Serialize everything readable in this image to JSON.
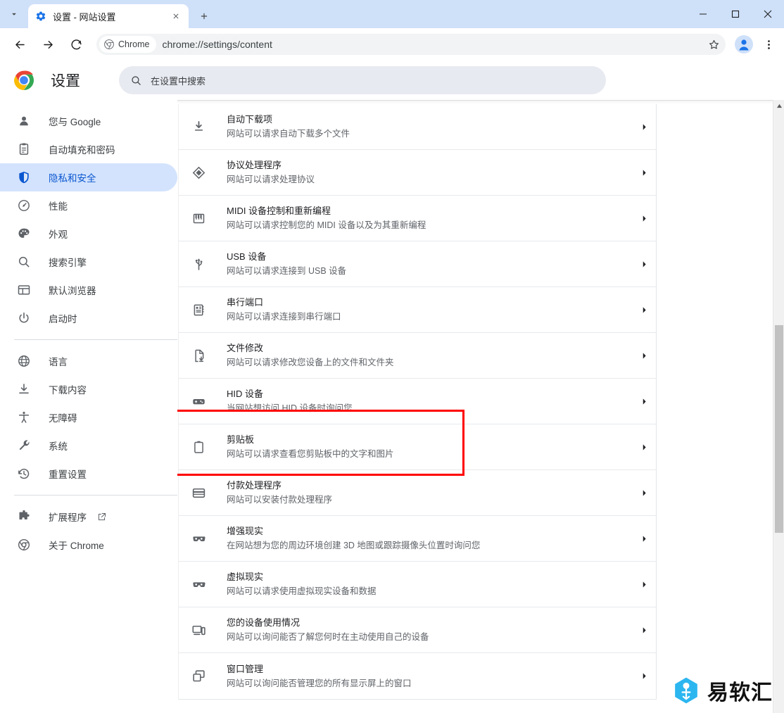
{
  "window": {
    "tab_title": "设置 - 网站设置",
    "tab_favicon_icon": "gear-icon",
    "tablist_icon": "chevron-down-icon",
    "newtab_icon": "plus-icon",
    "close_tab_icon": "close-icon",
    "minimize_label": "—",
    "maximize_label": "□",
    "close_label": "✕"
  },
  "toolbar": {
    "back_icon": "arrow-back-icon",
    "forward_icon": "arrow-forward-icon",
    "reload_icon": "reload-icon",
    "chrome_chip_label": "Chrome",
    "url": "chrome://settings/content",
    "star_icon": "star-icon",
    "profile_icon": "avatar-icon",
    "menu_icon": "three-dot-menu-icon"
  },
  "header": {
    "logo_icon": "chrome-logo-icon",
    "title": "设置",
    "search_icon": "search-icon",
    "search_placeholder": "在设置中搜索",
    "search_value": ""
  },
  "sidebar": {
    "groups": [
      {
        "items": [
          {
            "icon": "person-icon",
            "label": "您与 Google",
            "selected": false
          },
          {
            "icon": "clipboard-form-icon",
            "label": "自动填充和密码",
            "selected": false
          },
          {
            "icon": "shield-icon",
            "label": "隐私和安全",
            "selected": true
          },
          {
            "icon": "speedometer-icon",
            "label": "性能",
            "selected": false
          },
          {
            "icon": "palette-icon",
            "label": "外观",
            "selected": false
          },
          {
            "icon": "search-icon",
            "label": "搜索引擎",
            "selected": false
          },
          {
            "icon": "browser-window-icon",
            "label": "默认浏览器",
            "selected": false
          },
          {
            "icon": "power-icon",
            "label": "启动时",
            "selected": false
          }
        ]
      },
      {
        "items": [
          {
            "icon": "globe-icon",
            "label": "语言",
            "selected": false
          },
          {
            "icon": "download-icon",
            "label": "下载内容",
            "selected": false
          },
          {
            "icon": "accessibility-icon",
            "label": "无障碍",
            "selected": false
          },
          {
            "icon": "wrench-icon",
            "label": "系统",
            "selected": false
          },
          {
            "icon": "history-restore-icon",
            "label": "重置设置",
            "selected": false
          }
        ]
      },
      {
        "items": [
          {
            "icon": "puzzle-icon",
            "label": "扩展程序",
            "selected": false,
            "external": true,
            "external_icon": "open-in-new-icon"
          },
          {
            "icon": "chrome-outline-icon",
            "label": "关于 Chrome",
            "selected": false
          }
        ]
      }
    ]
  },
  "content": {
    "rows": [
      {
        "icon": "download-arrow-icon",
        "title": "自动下载项",
        "desc": "网站可以请求自动下载多个文件",
        "arrow": "chevron-right-icon"
      },
      {
        "icon": "protocol-diamond-icon",
        "title": "协议处理程序",
        "desc": "网站可以请求处理协议",
        "arrow": "chevron-right-icon"
      },
      {
        "icon": "midi-piano-icon",
        "title": "MIDI 设备控制和重新编程",
        "desc": "网站可以请求控制您的 MIDI 设备以及为其重新编程",
        "arrow": "chevron-right-icon"
      },
      {
        "icon": "usb-icon",
        "title": "USB 设备",
        "desc": "网站可以请求连接到 USB 设备",
        "arrow": "chevron-right-icon"
      },
      {
        "icon": "serial-port-icon",
        "title": "串行端口",
        "desc": "网站可以请求连接到串行端口",
        "arrow": "chevron-right-icon"
      },
      {
        "icon": "file-edit-icon",
        "title": "文件修改",
        "desc": "网站可以请求修改您设备上的文件和文件夹",
        "arrow": "chevron-right-icon"
      },
      {
        "icon": "hid-device-icon",
        "title": "HID 设备",
        "desc": "当网站想访问 HID 设备时询问您",
        "arrow": "chevron-right-icon"
      },
      {
        "icon": "clipboard-icon",
        "title": "剪贴板",
        "desc": "网站可以请求查看您剪贴板中的文字和图片",
        "arrow": "chevron-right-icon",
        "highlighted": true
      },
      {
        "icon": "payment-card-icon",
        "title": "付款处理程序",
        "desc": "网站可以安装付款处理程序",
        "arrow": "chevron-right-icon"
      },
      {
        "icon": "vr-goggles-icon",
        "title": "增强现实",
        "desc": "在网站想为您的周边环境创建 3D 地图或跟踪摄像头位置时询问您",
        "arrow": "chevron-right-icon"
      },
      {
        "icon": "vr-goggles-icon",
        "title": "虚拟现实",
        "desc": "网站可以请求使用虚拟现实设备和数据",
        "arrow": "chevron-right-icon"
      },
      {
        "icon": "device-usage-icon",
        "title": "您的设备使用情况",
        "desc": "网站可以询问能否了解您何时在主动使用自己的设备",
        "arrow": "chevron-right-icon"
      },
      {
        "icon": "window-manage-icon",
        "title": "窗口管理",
        "desc": "网站可以询问能否管理您的所有显示屏上的窗口",
        "arrow": "chevron-right-icon"
      }
    ]
  },
  "annotation": {
    "color": "#ff0000",
    "target": "剪贴板"
  },
  "watermark": {
    "text": "易软汇",
    "icon": "hexagon-logo-icon",
    "color": "#2bb6f0"
  },
  "scrollbar": {
    "up_arrow_icon": "scroll-up-arrow-icon"
  },
  "colors": {
    "accent": "#0b57d0",
    "tabstrip": "#cfe0f9",
    "selected_pill": "#d3e3fd"
  }
}
